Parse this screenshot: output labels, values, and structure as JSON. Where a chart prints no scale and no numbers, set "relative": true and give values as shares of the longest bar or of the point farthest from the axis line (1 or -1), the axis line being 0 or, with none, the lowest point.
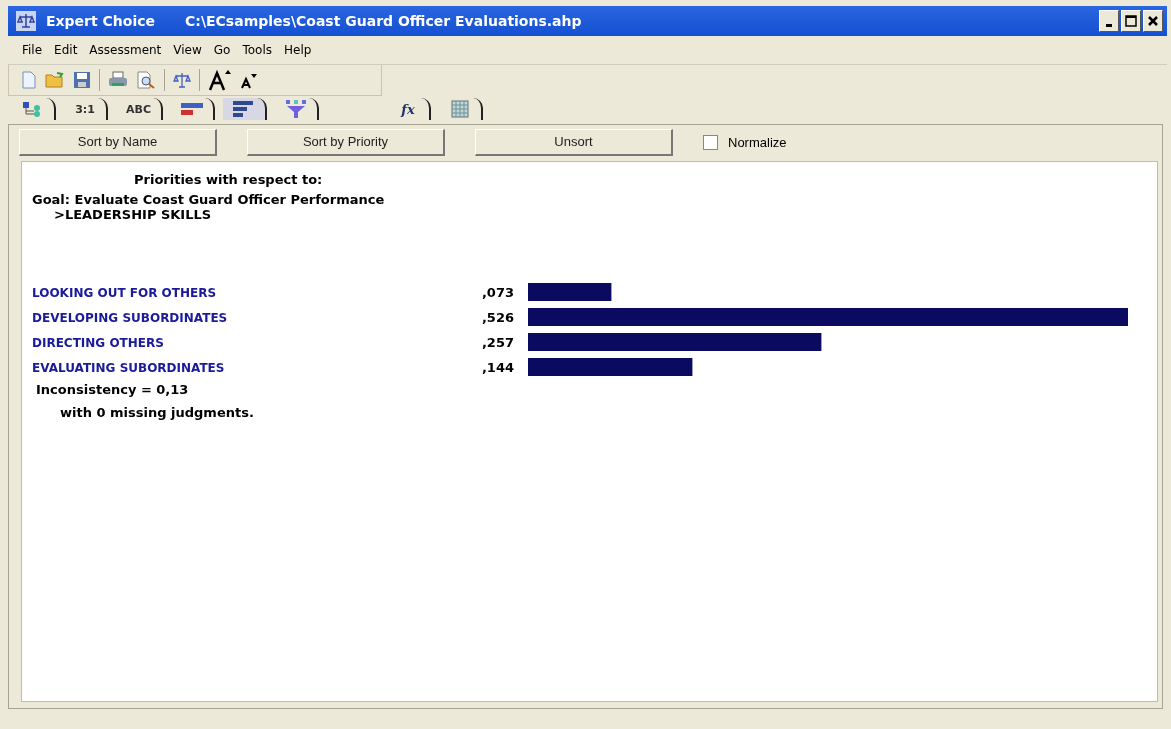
{
  "window": {
    "title": "Expert Choice",
    "path": "C:\\ECsamples\\Coast Guard Officer Evaluations.ahp"
  },
  "menu": [
    "File",
    "Edit",
    "Assessment",
    "View",
    "Go",
    "Tools",
    "Help"
  ],
  "tabs": [
    {
      "kind": "tree",
      "selected": false
    },
    {
      "kind": "text",
      "label": "3:1",
      "selected": false
    },
    {
      "kind": "text",
      "label": "ABC",
      "selected": false
    },
    {
      "kind": "redbars",
      "selected": false
    },
    {
      "kind": "bars",
      "selected": true
    },
    {
      "kind": "funnel",
      "selected": false
    },
    {
      "kind": "fx",
      "label": "fx",
      "selected": false
    },
    {
      "kind": "grid",
      "selected": false
    }
  ],
  "buttons": [
    "Sort by Name",
    "Sort by Priority",
    "Unsort"
  ],
  "normalize": {
    "label": "Normalize",
    "checked": false
  },
  "heading": "Priorities with respect to:",
  "goal": "Goal: Evaluate Coast Guard Officer Performance",
  "node": ">LEADERSHIP SKILLS",
  "chart_data": {
    "type": "bar",
    "orientation": "horizontal",
    "categories": [
      "LOOKING OUT FOR OTHERS",
      "DEVELOPING SUBORDINATES",
      "DIRECTING OTHERS",
      "EVALUATING SUBORDINATES"
    ],
    "values": [
      0.139,
      1.0,
      0.489,
      0.274
    ],
    "relative": true
  },
  "priority_values": [
    ",073",
    ",526",
    ",257",
    ",144"
  ],
  "inconsistency": "Inconsistency = 0,13",
  "missing": "with 0  missing judgments."
}
